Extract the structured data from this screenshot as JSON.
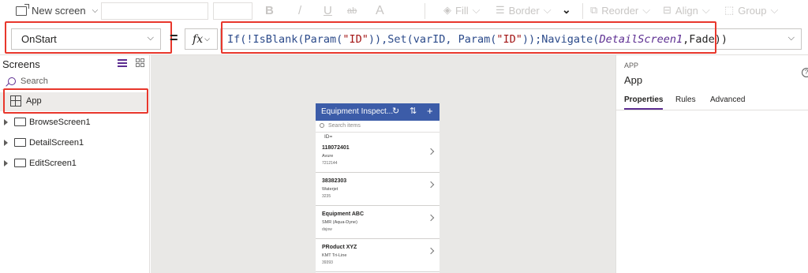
{
  "toolbar": {
    "new_screen_label": "New screen",
    "bold_glyph": "B",
    "italic_glyph": "/",
    "underline_glyph": "U",
    "strike_glyph": "ab",
    "fontcolor_glyph": "A",
    "fill_label": "Fill",
    "border_label": "Border",
    "reorder_label": "Reorder",
    "align_label": "Align",
    "group_label": "Group"
  },
  "formula_bar": {
    "property": "OnStart",
    "equals": "=",
    "fx_label": "fx",
    "tokens": [
      {
        "t": "If(!IsBlank(Param(",
        "c": "c-fn"
      },
      {
        "t": "\"ID\"",
        "c": "c-str"
      },
      {
        "t": ")),Set(varID, Param(",
        "c": "c-fn"
      },
      {
        "t": "\"ID\"",
        "c": "c-str"
      },
      {
        "t": "));Navigate(",
        "c": "c-fn"
      },
      {
        "t": "DetailScreen1",
        "c": "c-ctl"
      },
      {
        "t": ",Fade))",
        "c": "c-plain"
      }
    ]
  },
  "tree": {
    "title": "Screens",
    "search_placeholder": "Search",
    "items": [
      {
        "label": "App"
      },
      {
        "label": "BrowseScreen1"
      },
      {
        "label": "DetailScreen1"
      },
      {
        "label": "EditScreen1"
      }
    ]
  },
  "phone": {
    "title": "Equipment Inspect...",
    "refresh_glyph": "↻",
    "sort_glyph": "⇅",
    "add_glyph": "+",
    "search_placeholder": "Search items",
    "id_label": "ID=",
    "items": [
      {
        "title": "118072401",
        "subtitle": "Avure",
        "body": "7212144"
      },
      {
        "title": "38382303",
        "subtitle": "Waterjet",
        "body": "3235"
      },
      {
        "title": "Equipment ABC",
        "subtitle": "SMR (Aqua-Dyne)",
        "body": "dsjow"
      },
      {
        "title": "PRoduct XYZ",
        "subtitle": "KMT Tri-Line",
        "body": "39393"
      }
    ]
  },
  "properties": {
    "type_label": "APP",
    "name": "App",
    "help_glyph": "?",
    "tabs": [
      "Properties",
      "Rules",
      "Advanced"
    ]
  },
  "colors": {
    "highlight": "#e8372c",
    "accent": "#5c2d91",
    "phone_header": "#3c5ca8"
  }
}
